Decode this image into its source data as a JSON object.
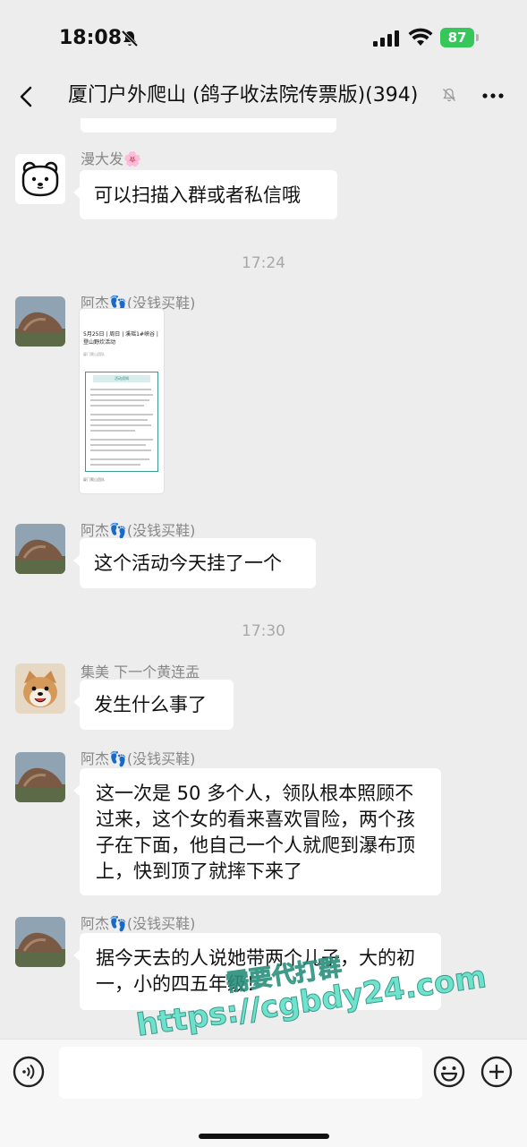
{
  "status_bar": {
    "time": "18:08",
    "battery": "87"
  },
  "header": {
    "title": "厦门户外爬山 (鸽子收法院传票版)(394)"
  },
  "messages": [
    {
      "sender": "漫大发🌸",
      "text": "可以扫描入群或者私信哦"
    },
    {
      "time": "17:24"
    },
    {
      "sender": "阿杰👣(没钱买鞋)",
      "poster_title": "5月25日 | 周日 | 溪瑶1#峡谷 | 登山野炊活动",
      "poster_org": "厦门爬山团队",
      "poster_box_title": "活动须知",
      "poster_footer": "厦门爬山团队"
    },
    {
      "sender": "阿杰👣(没钱买鞋)",
      "text": "这个活动今天挂了一个"
    },
    {
      "time": "17:30"
    },
    {
      "sender": "集美 下一个黄连盂",
      "text": "发生什么事了"
    },
    {
      "sender": "阿杰👣(没钱买鞋)",
      "text": "这一次是 50 多个人，领队根本照顾不过来，这个女的看来喜欢冒险，两个孩子在下面，他自己一个人就爬到瀑布顶上，快到顶了就摔下来了"
    },
    {
      "sender": "阿杰👣(没钱买鞋)",
      "text": "据今天去的人说她带两个儿子，大的初一，小的四五年级！"
    }
  ],
  "watermark": {
    "line1": "需要代打群",
    "line2": "https://cgbdy24.com"
  },
  "colors": {
    "background": "#ededed",
    "bubble": "#ffffff",
    "battery": "#35c759",
    "watermark": "#5fe0c8"
  }
}
